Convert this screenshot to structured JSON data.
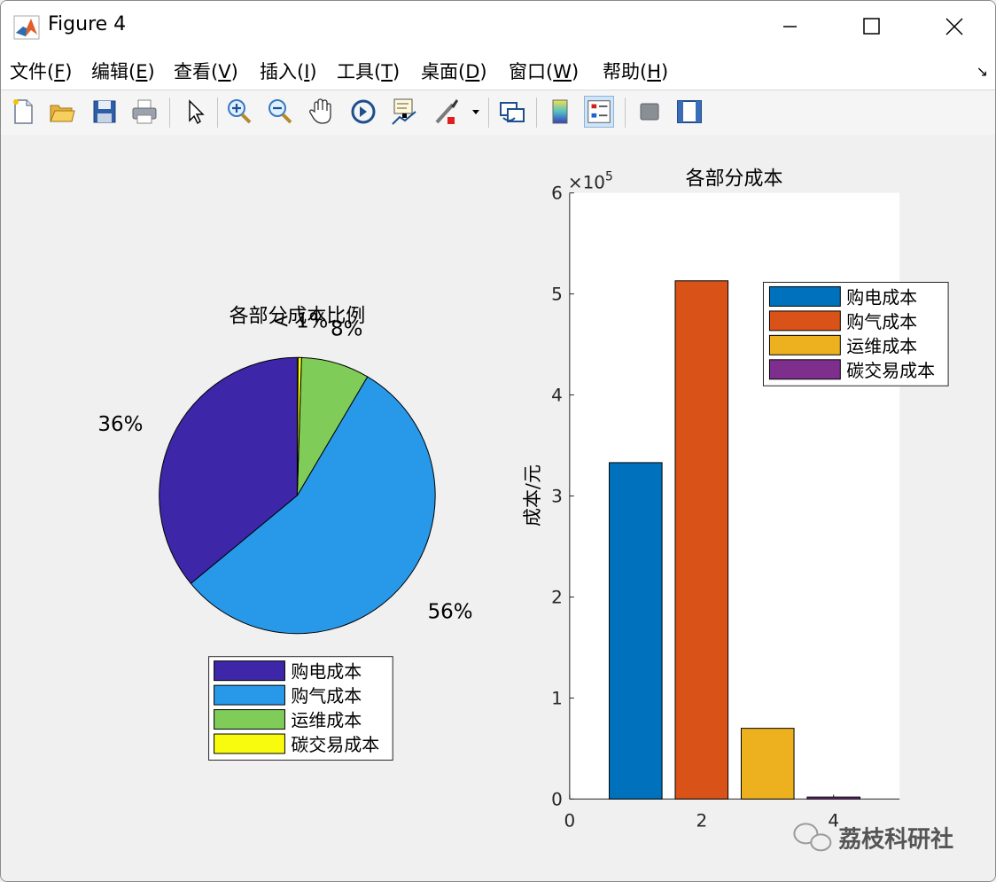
{
  "window": {
    "title": "Figure 4"
  },
  "menu": [
    {
      "label": "文件(",
      "key": "F",
      "tail": ")"
    },
    {
      "label": "编辑(",
      "key": "E",
      "tail": ")"
    },
    {
      "label": "查看(",
      "key": "V",
      "tail": ")"
    },
    {
      "label": "插入(",
      "key": "I",
      "tail": ")"
    },
    {
      "label": "工具(",
      "key": "T",
      "tail": ")"
    },
    {
      "label": "桌面(",
      "key": "D",
      "tail": ")"
    },
    {
      "label": "窗口(",
      "key": "W",
      "tail": ")"
    },
    {
      "label": "帮助(",
      "key": "H",
      "tail": ")"
    }
  ],
  "toolbar_icons": [
    "new-file-icon",
    "open-folder-icon",
    "save-icon",
    "print-icon",
    "pointer-icon",
    "zoom-in-icon",
    "zoom-out-icon",
    "pan-hand-icon",
    "rotate-3d-icon",
    "data-tips-icon",
    "brush-icon",
    "brush-dropdown-icon",
    "link-plot-icon",
    "colorbar-icon",
    "legend-icon",
    "hide-plot-tools-icon",
    "show-plot-tools-icon"
  ],
  "watermark": "荔枝科研社",
  "chart_data": [
    {
      "type": "pie",
      "title": "各部分成本比例",
      "slices": [
        {
          "name": "购电成本",
          "percent_label": "36%",
          "fraction": 0.36,
          "color": "#3d26a8"
        },
        {
          "name": "购气成本",
          "percent_label": "56%",
          "fraction": 0.555,
          "color": "#2898e8"
        },
        {
          "name": "运维成本",
          "percent_label": "8%",
          "fraction": 0.08,
          "color": "#7fcd58"
        },
        {
          "name": "碳交易成本",
          "percent_label": "< 1%",
          "fraction": 0.004,
          "color": "#f9fb0e"
        }
      ],
      "legend": [
        "购电成本",
        "购气成本",
        "运维成本",
        "碳交易成本"
      ],
      "legend_placement": "bottom"
    },
    {
      "type": "bar",
      "title": "各部分成本",
      "ylabel": "成本/元",
      "xlabel": "",
      "exponent_label": "×10",
      "exponent": "5",
      "x": [
        1,
        2,
        3,
        4
      ],
      "values": [
        3.33,
        5.13,
        0.7,
        0.02
      ],
      "series_names": [
        "购电成本",
        "购气成本",
        "运维成本",
        "碳交易成本"
      ],
      "colors": [
        "#0072bd",
        "#d95319",
        "#edb120",
        "#7e2f8e"
      ],
      "xlim": [
        0,
        5
      ],
      "ylim": [
        0,
        6
      ],
      "xticks": [
        "0",
        "2",
        "4"
      ],
      "yticks": [
        "0",
        "1",
        "2",
        "3",
        "4",
        "5",
        "6"
      ],
      "legend_placement": "top-right"
    }
  ]
}
